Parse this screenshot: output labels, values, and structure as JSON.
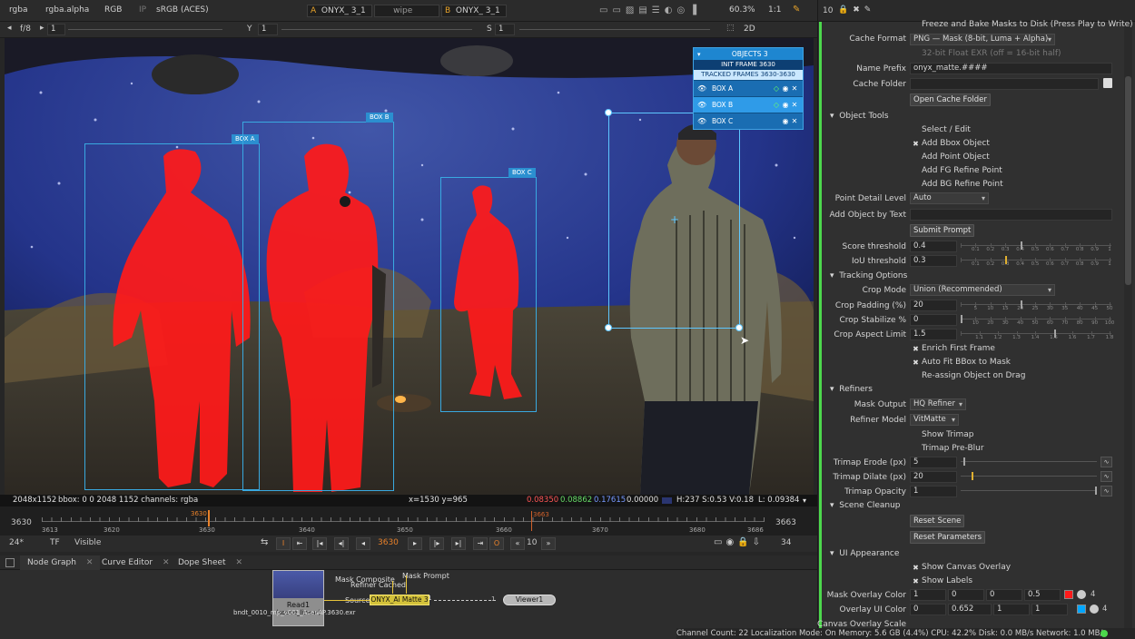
{
  "viewer_bar": {
    "channels": "rgba",
    "alpha": "rgba.alpha",
    "colorspace": "RGB",
    "lut_toggle": "IP",
    "view_transform": "sRGB (ACES)",
    "input_a_label": "A",
    "input_a": "ONYX_ 3_1",
    "wipe": "wipe",
    "input_b_label": "B",
    "input_b": "ONYX_ 3_1",
    "zoom": "60.3%",
    "ratio": "1:1"
  },
  "viewer_bar2": {
    "fstop": "f/8",
    "gain": "1",
    "y_label": "Y",
    "gamma": "1",
    "s_label": "S",
    "s_value": "1",
    "view_mode": "2D"
  },
  "objects_panel": {
    "header": "OBJECTS 3",
    "init_frame": "INIT FRAME 3630",
    "tracked": "TRACKED FRAMES 3630-3630",
    "rows": [
      {
        "label": "BOX A"
      },
      {
        "label": "BOX B"
      },
      {
        "label": "BOX C"
      }
    ]
  },
  "canvas_tags": {
    "box_a": "BOX A",
    "box_b": "BOX B",
    "box_c": "BOX C"
  },
  "info_bar": {
    "format": "2048x1152",
    "bbox": "bbox: 0 0 2048 1152 channels: rgba",
    "coords": "x=1530 y=965",
    "r": "0.08350",
    "g": "0.08862",
    "b": "0.17615",
    "a": "0.00000",
    "hsv": "H:237 S:0.53 V:0.18",
    "lum": "L: 0.09384"
  },
  "timeline": {
    "start": "3630",
    "end": "3663",
    "current": "3630",
    "marker": "3663",
    "ticks": [
      "3613",
      "3620",
      "3630",
      "3640",
      "3650",
      "3660",
      "3670",
      "3680",
      "3686"
    ]
  },
  "transport": {
    "fps": "24*",
    "tf": "TF",
    "visible": "Visible",
    "frame": "3630",
    "step": "10",
    "count": "34"
  },
  "tabs": [
    {
      "label": "Node Graph"
    },
    {
      "label": "Curve Editor"
    },
    {
      "label": "Dope Sheet"
    }
  ],
  "nodes": {
    "read_name": "Read1",
    "read_file": "bndt_0010_mp_v001_AcesAP.3630.exr",
    "read_space": "(scene_linear)",
    "mask_composite": "Mask Composite",
    "refiner_cached": "Refiner Cached",
    "mask_prompt": "Mask Prompt",
    "source": "Source",
    "onyx": "ONYX_Ai Matte 3",
    "onyx_num": "1",
    "viewer": "Viewer1",
    "viewer_num": "1"
  },
  "rpanel_top": {
    "count": "10"
  },
  "panel": {
    "freeze_bake": "Freeze and Bake Masks to Disk (Press Play to Write)",
    "cache_format_label": "Cache Format",
    "cache_format": "PNG — Mask (8-bit, Luma + Alpha)",
    "float_exr": "32-bit Float EXR (off = 16-bit half)",
    "name_prefix_label": "Name Prefix",
    "name_prefix": "onyx_matte.####",
    "cache_folder_label": "Cache Folder",
    "open_cache_folder": "Open Cache Folder",
    "object_tools": "Object Tools",
    "select_edit": "Select / Edit",
    "add_bbox": "Add Bbox Object",
    "add_point": "Add Point Object",
    "add_fg": "Add FG Refine Point",
    "add_bg": "Add BG Refine Point",
    "point_detail_label": "Point Detail Level",
    "point_detail": "Auto",
    "add_by_text_label": "Add Object by Text",
    "submit_prompt": "Submit Prompt",
    "score_label": "Score threshold",
    "score": "0.4",
    "iou_label": "IoU threshold",
    "iou": "0.3",
    "tracking_options": "Tracking Options",
    "crop_mode_label": "Crop Mode",
    "crop_mode": "Union (Recommended)",
    "crop_padding_label": "Crop Padding (%)",
    "crop_padding": "20",
    "crop_stabilize_label": "Crop Stabilize %",
    "crop_stabilize": "0",
    "crop_aspect_label": "Crop Aspect Limit",
    "crop_aspect": "1.5",
    "enrich": "Enrich First Frame",
    "auto_fit": "Auto Fit BBox to Mask",
    "reassign": "Re-assign Object on Drag",
    "refiners": "Refiners",
    "mask_output_label": "Mask Output",
    "mask_output": "HQ Refiner",
    "refiner_model_label": "Refiner Model",
    "refiner_model": "VitMatte",
    "show_trimap": "Show Trimap",
    "trimap_preblur": "Trimap Pre-Blur",
    "trimap_erode_label": "Trimap Erode (px)",
    "trimap_erode": "5",
    "trimap_dilate_label": "Trimap Dilate (px)",
    "trimap_dilate": "20",
    "trimap_opacity_label": "Trimap Opacity",
    "trimap_opacity": "1",
    "scene_cleanup": "Scene Cleanup",
    "reset_scene": "Reset Scene",
    "reset_params": "Reset Parameters",
    "ui_appearance": "UI Appearance",
    "show_canvas_overlay": "Show Canvas Overlay",
    "show_labels": "Show Labels",
    "mask_overlay_label": "Mask Overlay Color",
    "mask_overlay": [
      "1",
      "0",
      "0",
      "0.5"
    ],
    "overlay_ui_label": "Overlay UI Color",
    "overlay_ui": [
      "0",
      "0.652",
      "1",
      "1"
    ],
    "canvas_overlay_scale_label": "Canvas Overlay Scale",
    "color_count_a": "4",
    "color_count_b": "4"
  },
  "score_ticks": [
    "0",
    "0.1",
    "0.2",
    "0.3",
    "0.4",
    "0.5",
    "0.6",
    "0.7",
    "0.8",
    "0.9",
    "1"
  ],
  "crop_pad_ticks": [
    "0",
    "5",
    "10",
    "15",
    "20",
    "25",
    "30",
    "35",
    "40",
    "45",
    "50"
  ],
  "crop_stab_ticks": [
    "0",
    "10",
    "20",
    "30",
    "40",
    "50",
    "60",
    "70",
    "80",
    "90",
    "100"
  ],
  "crop_aspect_ticks": [
    "1",
    "1.1",
    "1.2",
    "1.3",
    "1.4",
    "1.5",
    "1.6",
    "1.7",
    "1.8"
  ],
  "status_bar": "Channel Count: 22  Localization Mode: On  Memory: 5.6 GB (4.4%)  CPU: 42.2%  Disk: 0.0 MB/s  Network: 1.0 MB/s",
  "colors": {
    "mask_red": "#ff1a1a",
    "ui_blue": "#39a9e0",
    "tag_blue": "#2b8fd0",
    "accent_orange": "#e8812a"
  }
}
